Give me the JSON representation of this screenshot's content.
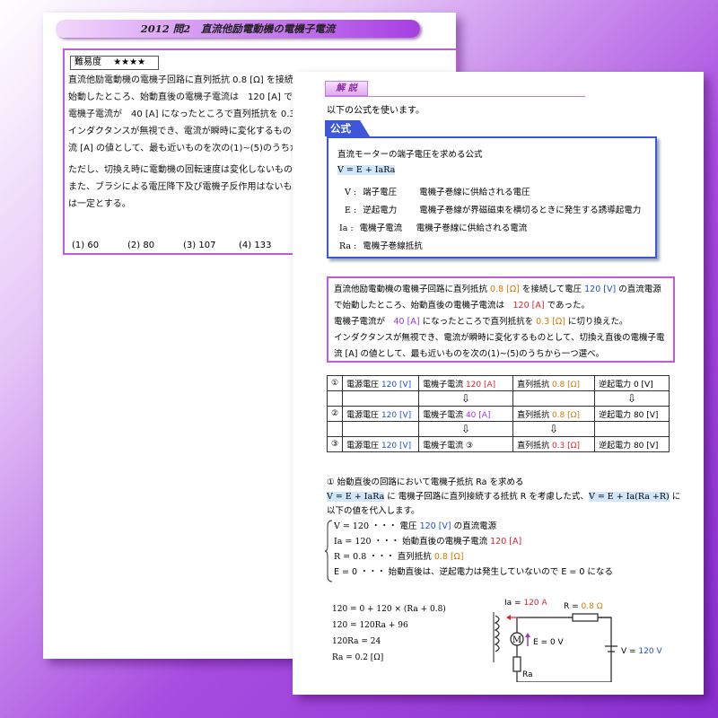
{
  "back_page": {
    "title": "2012 問2　直流他励電動機の電機子電流",
    "difficulty_label": "難易度",
    "difficulty_stars": "★★★★",
    "question_lines": [
      "直流他励電動機の電機子回路に直列抵抗 0.8 [Ω] を接続",
      "始動したところ、始動直後の電機子電流は　120 [A] であ",
      "電機子電流が　40 [A] になったところで直列抵抗を 0.3 [Ω",
      "インダクタンスが無視でき、電流が瞬時に変化するもの",
      "流 [A] の値として、最も近いものを次の(1)~(5)のうちか",
      "",
      "ただし、切換え時に電動機の回転速度は変化しないもの",
      "また、ブラシによる電圧降下及び電機子反作用はないも",
      "は一定とする。"
    ],
    "options": [
      "(1) 60",
      "(2) 80",
      "(3) 107",
      "(4) 133",
      "("
    ]
  },
  "front_page": {
    "kaisetsu": "解 説",
    "intro": "以下の公式を使います。",
    "formula_tab": "公式",
    "formula": {
      "heading": "直流モーターの端子電圧を求める公式",
      "equation": "V = E + IaRa",
      "vars": [
        {
          "sym": "V :",
          "name": "端子電圧",
          "desc": "電機子巻線に供給される電圧"
        },
        {
          "sym": "E :",
          "name": "逆起電力",
          "desc": "電機子巻線が界磁磁束を横切るときに発生する誘導起電力"
        },
        {
          "sym": "Ia :",
          "name": "電機子電流",
          "desc": "電機子巻線に供給される電流"
        },
        {
          "sym": "Ra :",
          "name": "電機子巻線抵抗",
          "desc": ""
        }
      ]
    },
    "question": {
      "l1a": "直流他励電動機の電機子回路に直列抵抗 ",
      "l1b": "0.8 [Ω]",
      "l1c": " を接続して電圧 ",
      "l1d": "120 [V]",
      "l1e": " の直流電源",
      "l2a": "で始動したところ、始動直後の電機子電流は　",
      "l2b": "120 [A]",
      "l2c": " であった。",
      "l3a": "電機子電流が　",
      "l3b": "40 [A]",
      "l3c": " になったところで直列抵抗を ",
      "l3d": "0.3 [Ω]",
      "l3e": " に切り換えた。",
      "l4": "インダクタンスが無視でき、電流が瞬時に変化するものとして、切換え直後の電機子電",
      "l5": "流 [A] の値として、最も近いものを次の(1)~(5)のうちから一つ選べ。"
    },
    "steps": [
      {
        "no": "①",
        "v_label": "電源電圧 ",
        "v_val": "120 [V]",
        "i_label": "電機子電流 ",
        "i_val": "120 [A]",
        "r_label": "直列抵抗 ",
        "r_val": "0.8 [Ω]",
        "e_label": "逆起電力 0 [V]"
      },
      {
        "no": "②",
        "v_label": "電源電圧 ",
        "v_val": "120 [V]",
        "i_label": "電機子電流 ",
        "i_val": "40 [A]",
        "r_label": "直列抵抗 ",
        "r_val": "0.8 [Ω]",
        "e_label": "逆起電力 80 [V]"
      },
      {
        "no": "③",
        "v_label": "電源電圧 ",
        "v_val": "120 [V]",
        "i_label": "電機子電流 ③",
        "i_val": "",
        "r_label": "直列抵抗 ",
        "r_val": "0.3 [Ω]",
        "e_label": "逆起電力 80 [V]"
      }
    ],
    "arrow": "⇩",
    "solution": {
      "step_heading": "①  始動直後の回路において電機子抵抗 Ra を求める",
      "line2a": "V = E + IaRa",
      "line2b": " に  電機子回路に直列接続する抵抗 R を考慮した式、",
      "line2c": "V = E + Ia(Ra +R)",
      "line2d": " に",
      "line3": "以下の値を代入します。",
      "subs": [
        {
          "a": "V = 120  ・・・  電圧 ",
          "b": "120 [V]",
          "c": " の直流電源"
        },
        {
          "a": "Ia = 120  ・・・  始動直後の電機子電流  ",
          "b": "120 [A]",
          "c": ""
        },
        {
          "a": "R = 0.8  ・・・  直列抵抗 ",
          "b": "0.8 [Ω]",
          "c": ""
        },
        {
          "a": "E = 0  ・・・  始動直後は、逆起電力は発生していないので  E = 0  になる",
          "b": "",
          "c": ""
        }
      ]
    },
    "calc": [
      "120 = 0 + 120 × (Ra + 0.8)",
      "120 = 120Ra + 96",
      "120Ra = 24",
      "Ra = 0.2 [Ω]"
    ],
    "circuit": {
      "ia": "Ia = ",
      "ia_val": "120 A",
      "r": "R = ",
      "r_val": "0.8 Ω",
      "e": "E = 0 V",
      "v": "V = ",
      "v_val": "120 V",
      "ra": "Ra",
      "m": "M"
    }
  }
}
